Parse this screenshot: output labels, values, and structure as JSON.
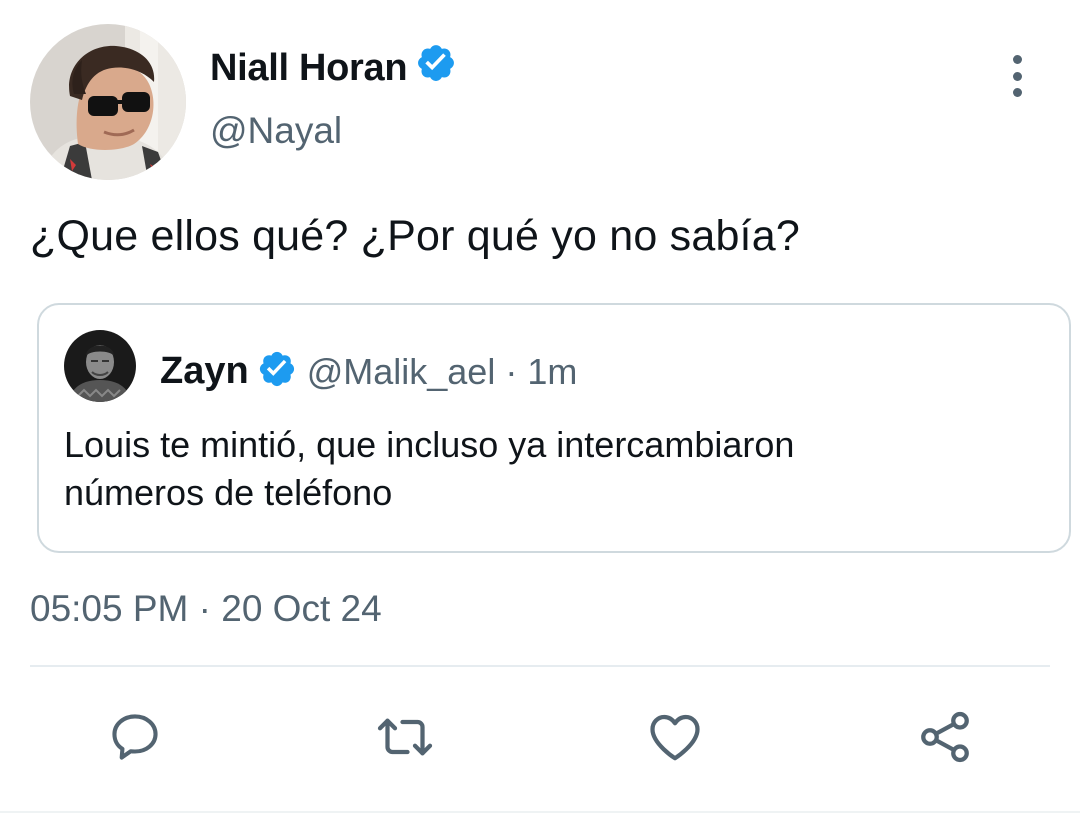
{
  "tweet": {
    "author": {
      "name": "Niall Horan",
      "handle": "@Nayal",
      "verified": true
    },
    "text": "¿Que ellos qué? ¿Por qué yo no sabía?",
    "timestamp": "05:05 PM · 20 Oct 24",
    "quoted": {
      "name": "Zayn",
      "handle": "@Malik_ael",
      "separator": "·",
      "time": "1m",
      "verified": true,
      "text_line1": "Louis te mintió, que incluso ya intercambiaron",
      "text_line2": "números de teléfono"
    }
  },
  "icons": {
    "more": "more-vertical-icon",
    "reply": "reply-icon",
    "retweet": "retweet-icon",
    "like": "heart-icon",
    "share": "share-icon",
    "verified": "verified-badge-icon"
  },
  "colors": {
    "verified_blue": "#1d9bf0",
    "secondary_text": "#536471",
    "primary_text": "#0f1419",
    "border": "#cfd9de"
  }
}
